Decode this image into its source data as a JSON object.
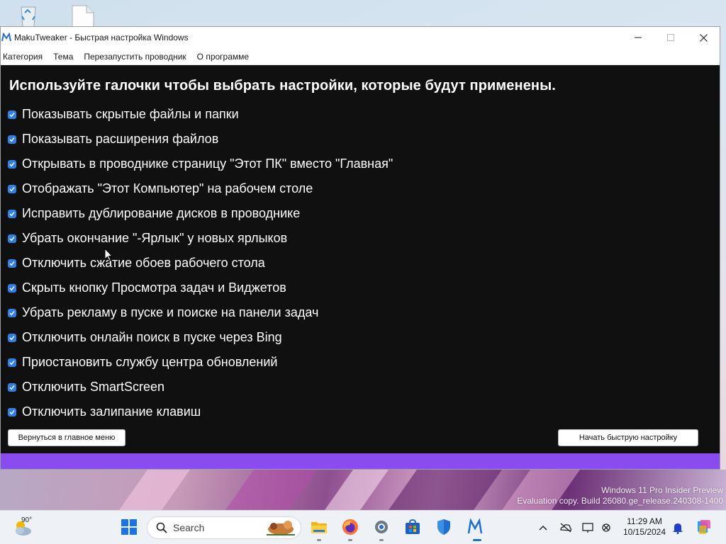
{
  "window": {
    "title": "MakuTweaker - Быстрая настройка Windows"
  },
  "menu": {
    "items": [
      "Категория",
      "Тема",
      "Перезапустить проводник",
      "О программе"
    ]
  },
  "main": {
    "heading": "Используйте галочки чтобы выбрать настройки, которые будут применены.",
    "options": [
      {
        "label": "Показывать скрытые файлы и папки",
        "checked": true
      },
      {
        "label": "Показывать расширения файлов",
        "checked": true
      },
      {
        "label": "Открывать в проводнике страницу \"Этот ПК\" вместо \"Главная\"",
        "checked": true
      },
      {
        "label": "Отображать \"Этот Компьютер\" на рабочем столе",
        "checked": true
      },
      {
        "label": "Исправить дублирование дисков в проводнике",
        "checked": true
      },
      {
        "label": "Убрать окончание \"-Ярлык\" у новых ярлыков",
        "checked": true
      },
      {
        "label": "Отключить сжатие обоев рабочего стола",
        "checked": true
      },
      {
        "label": "Скрыть кнопку Просмотра задач и Виджетов",
        "checked": true
      },
      {
        "label": "Убрать рекламу в пуске и поиске на панели задач",
        "checked": true
      },
      {
        "label": "Отключить онлайн поиск в пуске через Bing",
        "checked": true
      },
      {
        "label": "Приостановить службу центра обновлений",
        "checked": true
      },
      {
        "label": "Отключить SmartScreen",
        "checked": true
      },
      {
        "label": "Отключить залипание клавиш",
        "checked": true
      }
    ],
    "back_button": "Вернуться в главное меню",
    "start_button": "Начать быструю настройку"
  },
  "desktop": {
    "watermark_line1": "Windows 11 Pro Insider Preview",
    "watermark_line2": "Evaluation copy. Build 26080.ge_release.240308-1400"
  },
  "taskbar": {
    "weather_temp": "90°",
    "search_placeholder": "Search",
    "apps": [
      "start-icon",
      "search-icon",
      "file-explorer-icon",
      "firefox-icon",
      "settings-icon",
      "store-icon",
      "defender-icon",
      "makutweaker-icon"
    ],
    "clock_time": "11:29 AM",
    "clock_date": "10/15/2024"
  },
  "colors": {
    "accent": "#8a4cf0",
    "checkbox": "#2f7fe6",
    "content_bg": "#101010"
  }
}
